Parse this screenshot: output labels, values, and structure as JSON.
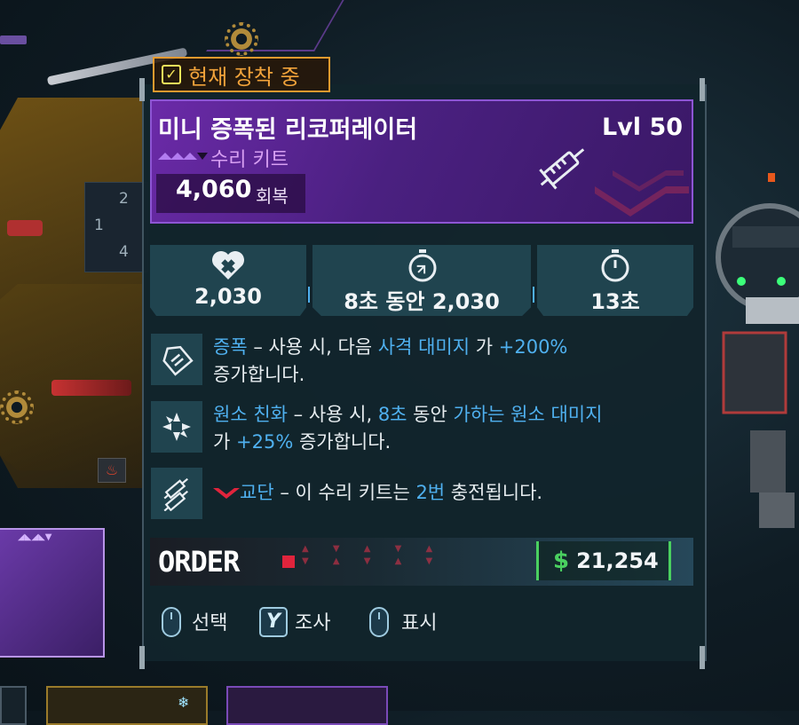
{
  "equipped": {
    "label": "현재 장착 중"
  },
  "item": {
    "name": "미니 증폭된 리코퍼레이터",
    "level": "Lvl 50",
    "type": "수리 키트",
    "recovery_value": "4,060",
    "recovery_label": "회복",
    "rarity_color": "#b27cf0"
  },
  "stats": [
    {
      "icon": "heart-cross-icon",
      "value": "2,030"
    },
    {
      "icon": "regen-timer-icon",
      "value": "8초 동안 2,030"
    },
    {
      "icon": "stopwatch-icon",
      "value": "13초"
    }
  ],
  "perks": [
    {
      "icon": "shield-badge-icon",
      "name": "증폭",
      "dash": " – 사용 시, 다음 ",
      "hl1": "사격 대미지",
      "mid": " 가 ",
      "hl2": "+200%",
      "line2": "증가합니다."
    },
    {
      "icon": "elemental-burst-icon",
      "name": "원소 친화",
      "dash": " – 사용 시, ",
      "hl1": "8초",
      "mid": " 동안 ",
      "hl2": "가하는 원소 대미지",
      "line2a": "가 ",
      "line2hl": "+25%",
      "line2b": " 증가합니다."
    },
    {
      "icon": "twin-syringe-icon",
      "name": "교단",
      "dash": " – 이 수리 키트는 ",
      "hl1": "2번",
      "tail": " 충전됩니다."
    }
  ],
  "manufacturer": {
    "logo_text": "ORDER",
    "accent": "#e0243c"
  },
  "price": {
    "symbol": "$",
    "value": "21,254"
  },
  "controls": [
    {
      "icon": "mouse-left-icon",
      "label": "선택"
    },
    {
      "icon": "y-button-icon",
      "key": "Y",
      "label": "조사"
    },
    {
      "icon": "mouse-right-icon",
      "label": "표시"
    }
  ],
  "background": {
    "slot_numbers": [
      "2",
      "1",
      "4"
    ]
  },
  "colors": {
    "highlight": "#4fb0ef",
    "equipped": "#e69a2e",
    "price_border": "#4ad060",
    "header_purple": "#6b2aa8"
  }
}
